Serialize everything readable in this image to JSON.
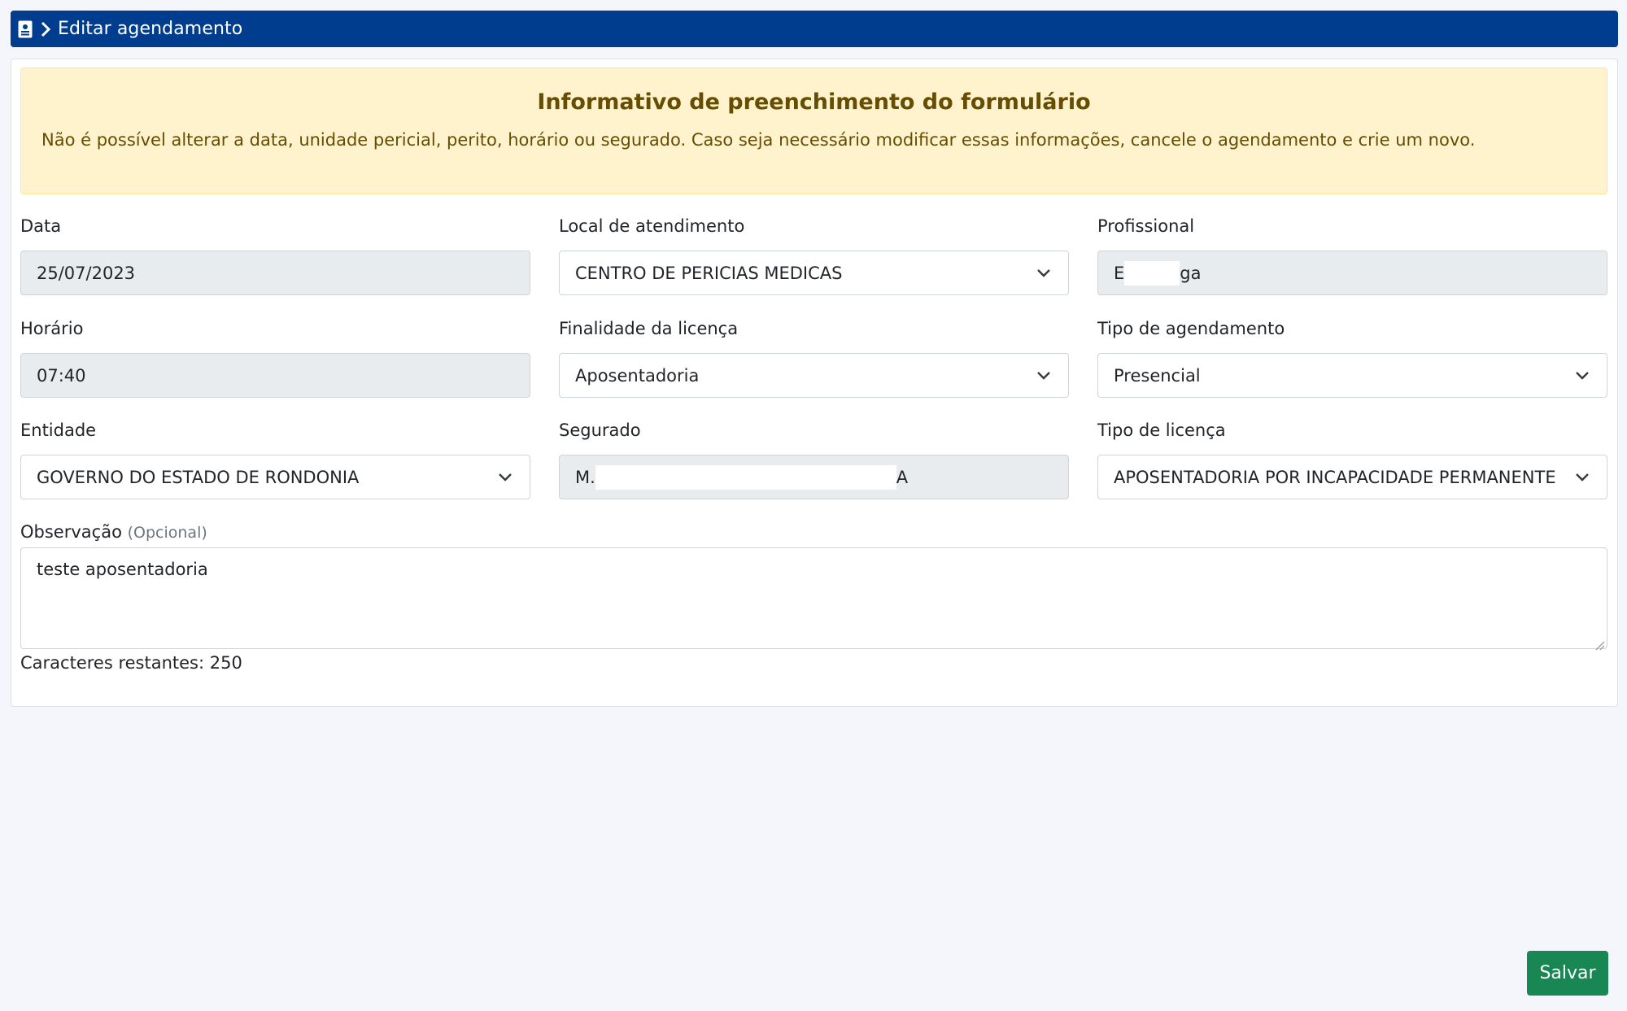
{
  "header": {
    "title": "Editar agendamento",
    "icon": "id-card-icon",
    "color": "#003d8f"
  },
  "alert": {
    "title": "Informativo de preenchimento do formulário",
    "text": "Não é possível alterar a data, unidade pericial, perito, horário ou segurado. Caso seja necessário modificar essas informações, cancele o agendamento e crie um novo."
  },
  "form": {
    "data": {
      "label": "Data",
      "value": "25/07/2023"
    },
    "local": {
      "label": "Local de atendimento",
      "value": "CENTRO DE PERICIAS MEDICAS"
    },
    "profissional": {
      "label": "Profissional",
      "value_start": "E",
      "value_end": "ga"
    },
    "horario": {
      "label": "Horário",
      "value": "07:40"
    },
    "finalidade": {
      "label": "Finalidade da licença",
      "value": "Aposentadoria"
    },
    "tipo_agendamento": {
      "label": "Tipo de agendamento",
      "value": "Presencial"
    },
    "entidade": {
      "label": "Entidade",
      "value": "GOVERNO DO ESTADO DE RONDONIA"
    },
    "segurado": {
      "label": "Segurado",
      "value_start": "M.",
      "value_end": "A"
    },
    "tipo_licenca": {
      "label": "Tipo de licença",
      "value": "APOSENTADORIA POR INCAPACIDADE PERMANENTE"
    },
    "observacao": {
      "label": "Observação",
      "optional": "(Opcional)",
      "value": "teste aposentadoria"
    },
    "char_counter": "Caracteres restantes: 250"
  },
  "actions": {
    "save_label": "Salvar",
    "save_color": "#198754"
  }
}
